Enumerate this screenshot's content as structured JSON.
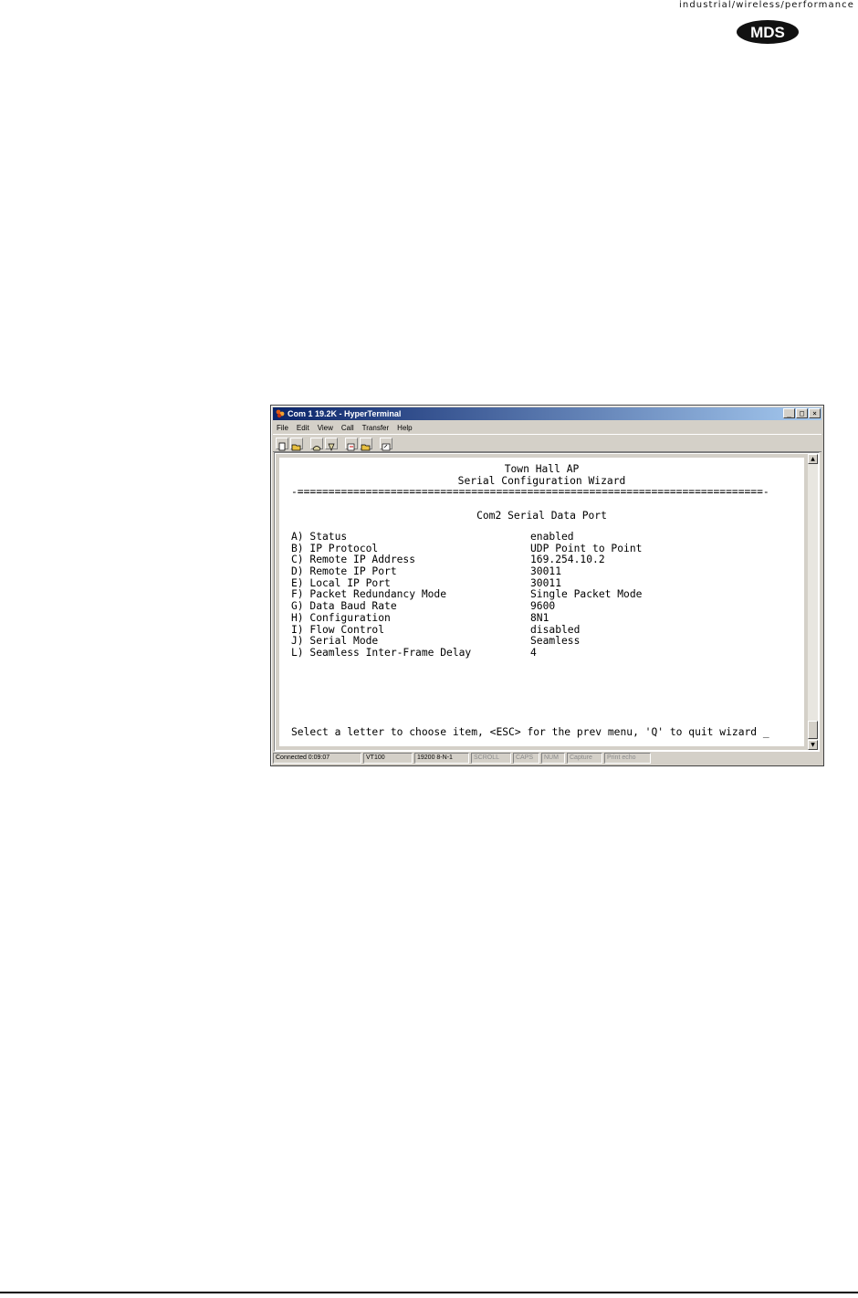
{
  "header": {
    "tagline": "industrial/wireless/performance",
    "logo_text": "MDS"
  },
  "window": {
    "title": "Com 1 19.2K - HyperTerminal",
    "caption_buttons": {
      "minimize": "_",
      "maximize": "□",
      "close": "×"
    },
    "menu": [
      "File",
      "Edit",
      "View",
      "Call",
      "Transfer",
      "Help"
    ]
  },
  "terminal": {
    "device_name": "Town Hall AP",
    "wizard_title": "Serial Configuration Wizard",
    "divider": "-===========================================================================-",
    "section_title": "Com2 Serial Data Port",
    "items": [
      {
        "label": "A) Status",
        "value": "enabled"
      },
      {
        "label": "B) IP Protocol",
        "value": "UDP Point to Point"
      },
      {
        "label": "C) Remote IP Address",
        "value": "169.254.10.2"
      },
      {
        "label": "D) Remote IP Port",
        "value": "30011"
      },
      {
        "label": "E) Local IP Port",
        "value": "30011"
      },
      {
        "label": "F) Packet Redundancy Mode",
        "value": "Single Packet Mode"
      },
      {
        "label": "G) Data Baud Rate",
        "value": "9600"
      },
      {
        "label": "H) Configuration",
        "value": "8N1"
      },
      {
        "label": "I) Flow Control",
        "value": "disabled"
      },
      {
        "label": "J) Serial Mode",
        "value": "Seamless"
      },
      {
        "label": "L) Seamless Inter-Frame Delay",
        "value": "4"
      }
    ],
    "prompt": "Select a letter to choose item, <ESC> for the prev menu, 'Q' to quit wizard _"
  },
  "status_bar": {
    "connected": "Connected 0:09:07",
    "emulation": "VT100",
    "settings": "19200 8-N-1",
    "scroll": "SCROLL",
    "caps": "CAPS",
    "num": "NUM",
    "capture": "Capture",
    "print_echo": "Print echo"
  }
}
